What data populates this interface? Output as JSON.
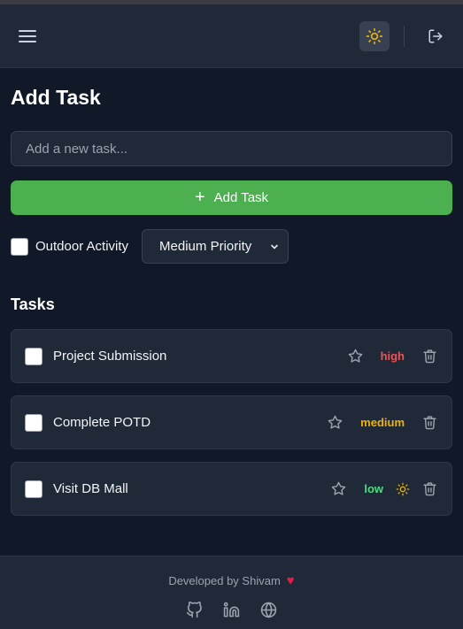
{
  "header": {
    "menu_icon": "hamburger-icon",
    "theme_icon": "sun-icon",
    "logout_icon": "logout-icon",
    "accent": "#eab308"
  },
  "form": {
    "title": "Add Task",
    "input_placeholder": "Add a new task...",
    "input_value": "",
    "add_button_label": "Add Task",
    "add_button_color": "#4caf50",
    "outdoor_label": "Outdoor Activity",
    "outdoor_checked": false,
    "priority_selected": "Medium Priority"
  },
  "tasks": {
    "title": "Tasks",
    "items": [
      {
        "text": "Project Submission",
        "priority": "high",
        "priority_color": "#f05252",
        "completed": false,
        "weather": false
      },
      {
        "text": "Complete POTD",
        "priority": "medium",
        "priority_color": "#eab308",
        "completed": false,
        "weather": false
      },
      {
        "text": "Visit DB Mall",
        "priority": "low",
        "priority_color": "#4ade80",
        "completed": false,
        "weather": true
      }
    ]
  },
  "footer": {
    "credit": "Developed by Shivam",
    "heart": "♥",
    "social_icons": [
      "github-icon",
      "linkedin-icon",
      "globe-icon"
    ]
  }
}
